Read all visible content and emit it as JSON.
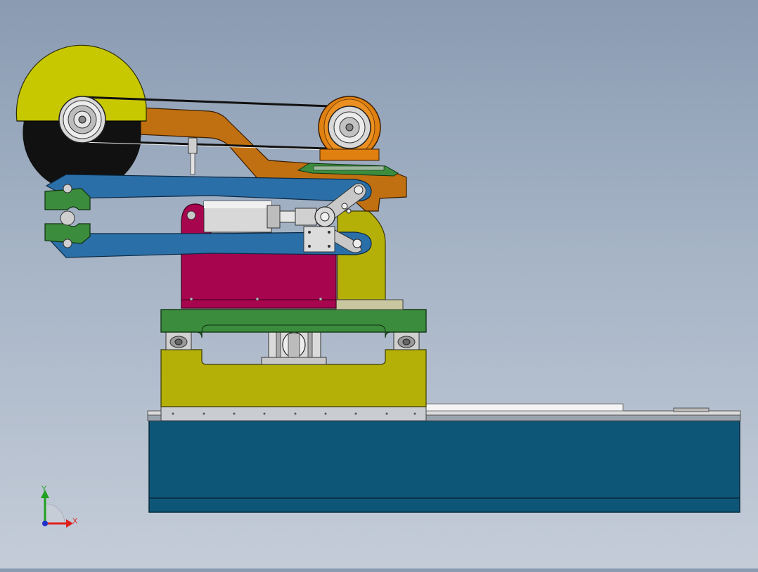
{
  "viewport": {
    "background_top": "#8a9bb2",
    "background_bottom": "#c4ccd8"
  },
  "triad": {
    "x_label": "X",
    "y_label": "Y",
    "x_color": "#e0201c",
    "y_color": "#20a020",
    "z_color": "#2030c8"
  },
  "model": {
    "colors": {
      "base_blue": "#0d5678",
      "carriage_yellow": "#b5b007",
      "plate_green": "#3c8c3e",
      "clamp_magenta": "#a8054f",
      "arm_blue": "#2b6fa8",
      "arm_orange": "#c07010",
      "disc_yellow": "#c8c800",
      "disc_black": "#111111",
      "pulley_orange": "#e08010",
      "silver": "#c8c8c8"
    }
  }
}
